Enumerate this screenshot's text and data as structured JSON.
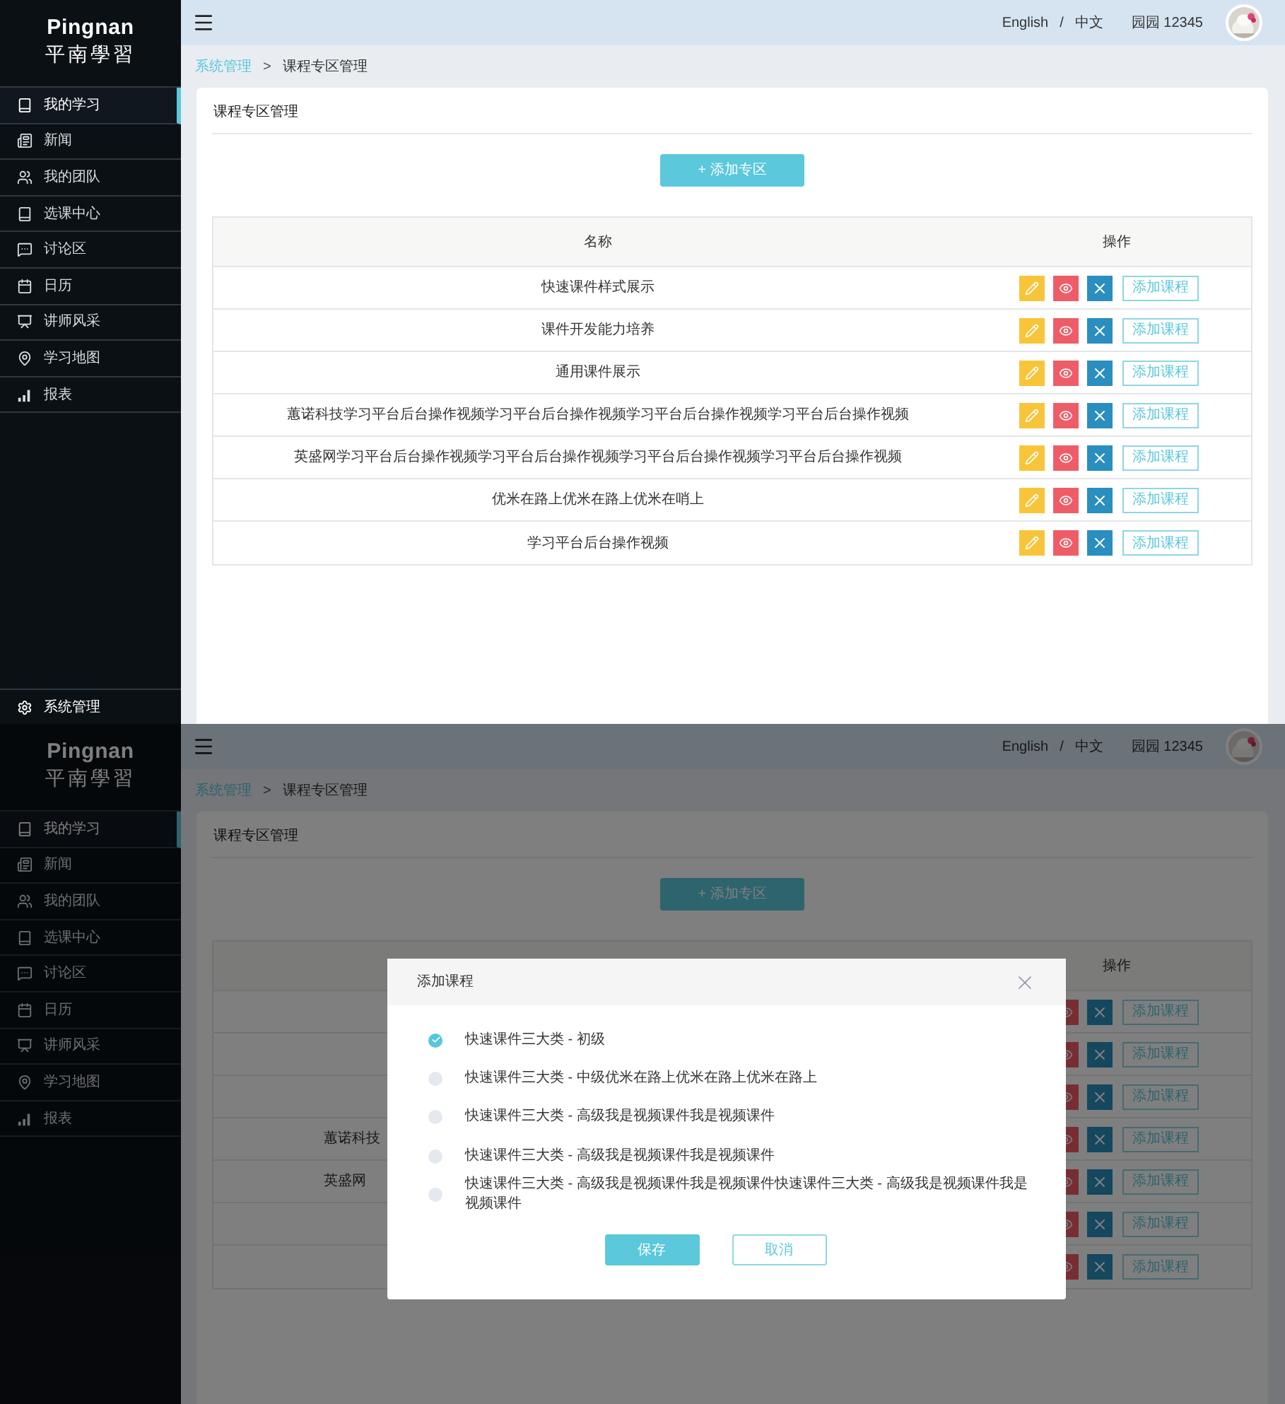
{
  "screens": [
    {
      "sidebar": {
        "brand": "Pingnan",
        "brand_sub": "平南學習",
        "items": [
          {
            "label": "我的学习",
            "selected": true
          },
          {
            "label": "新闻",
            "selected": false
          },
          {
            "label": "我的团队",
            "selected": false
          },
          {
            "label": "选课中心",
            "selected": false
          },
          {
            "label": "讨论区",
            "selected": false
          },
          {
            "label": "日历",
            "selected": false
          },
          {
            "label": "讲师风采",
            "selected": false
          },
          {
            "label": "学习地图",
            "selected": false
          },
          {
            "label": "报表",
            "selected": false
          }
        ],
        "footer_item": "系统管理"
      },
      "header": {
        "languages": [
          "English",
          "中文"
        ],
        "separator": "/",
        "user": "园园 12345"
      },
      "breadcrumb": {
        "separator": ">",
        "items": [
          {
            "label": "系统管理",
            "link": true
          },
          {
            "label": "课程专区管理",
            "link": false
          }
        ]
      },
      "card_title": "课程专区管理",
      "add_button": "+ 添加专区",
      "table": {
        "name_header": "名称",
        "actions_header": "操作",
        "row_tools": [
          {
            "kind": "edit"
          },
          {
            "kind": "view"
          },
          {
            "kind": "delete"
          }
        ],
        "rows": [
          {
            "name": "快速课件样式展示",
            "action_label": "添加课程"
          },
          {
            "name": "课件开发能力培养",
            "action_label": "添加课程"
          },
          {
            "name": "通用课件展示",
            "action_label": "添加课程"
          },
          {
            "name": "蕙诺科技学习平台后台操作视频学习平台后台操作视频学习平台后台操作视频学习平台后台操作视频",
            "action_label": "添加课程"
          },
          {
            "name": "英盛网学习平台后台操作视频学习平台后台操作视频学习平台后台操作视频学习平台后台操作视频",
            "action_label": "添加课程"
          },
          {
            "name": "优米在路上优米在路上优米在哨上",
            "action_label": "添加课程"
          },
          {
            "name": "学习平台后台操作视频",
            "action_label": "添加课程"
          }
        ]
      }
    },
    {
      "sidebar": {
        "brand": "Pingnan",
        "brand_sub": "平南學習",
        "items": [
          {
            "label": "我的学习",
            "selected": true
          },
          {
            "label": "新闻",
            "selected": false
          },
          {
            "label": "我的团队",
            "selected": false
          },
          {
            "label": "选课中心",
            "selected": false
          },
          {
            "label": "讨论区",
            "selected": false
          },
          {
            "label": "日历",
            "selected": false
          },
          {
            "label": "讲师风采",
            "selected": false
          },
          {
            "label": "学习地图",
            "selected": false
          },
          {
            "label": "报表",
            "selected": false
          }
        ]
      },
      "header": {
        "languages": [
          "English",
          "中文"
        ],
        "separator": "/",
        "user": "园园 12345"
      },
      "breadcrumb": {
        "separator": ">",
        "items": [
          {
            "label": "系统管理",
            "link": true
          },
          {
            "label": "课程专区管理",
            "link": false
          }
        ]
      },
      "card_title": "课程专区管理",
      "add_button": "+ 添加专区",
      "table": {
        "actions_header": "操作",
        "row_tools": [
          {
            "kind": "view"
          },
          {
            "kind": "delete"
          }
        ],
        "rows": [
          {
            "action_label": "添加课程"
          },
          {
            "action_label": "添加课程"
          },
          {
            "action_label": "添加课程"
          },
          {
            "name": "蕙诺科技",
            "action_label": "添加课程"
          },
          {
            "name": "英盛网",
            "action_label": "添加课程"
          },
          {
            "action_label": "添加课程"
          },
          {
            "action_label": "添加课程"
          }
        ]
      },
      "dialog": {
        "title": "添加课程",
        "options": [
          {
            "label": "快速课件三大类 - 初级",
            "selected": true
          },
          {
            "label": "快速课件三大类 - 中级优米在路上优米在路上优米在路上",
            "selected": false
          },
          {
            "label": "快速课件三大类 - 高级我是视频课件我是视频课件",
            "selected": false
          },
          {
            "label": "快速课件三大类 - 高级我是视频课件我是视频课件",
            "selected": false
          },
          {
            "label": "快速课件三大类 - 高级我是视频课件我是视频课件快速课件三大类 - 高级我是视频课件我是视频课件",
            "selected": false
          }
        ],
        "buttons": [
          {
            "label": "保存",
            "kind": "primary"
          },
          {
            "label": "取消",
            "kind": "secondary"
          }
        ]
      }
    }
  ]
}
